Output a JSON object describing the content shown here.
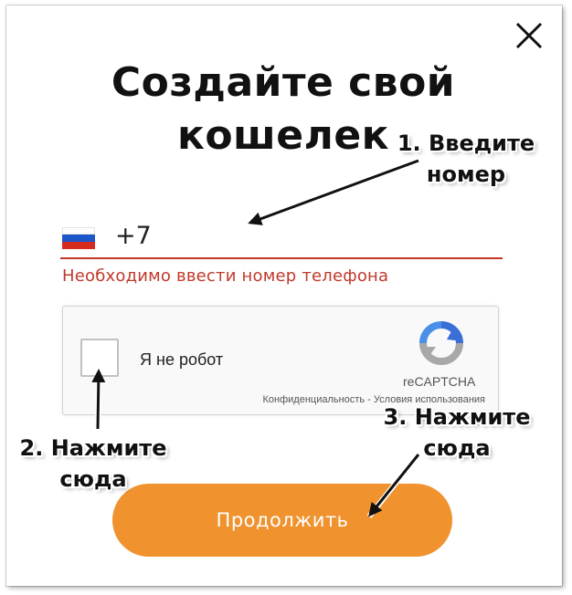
{
  "dialog": {
    "title_line1": "Создайте свой",
    "title_line2": "кошелек"
  },
  "phone": {
    "country_flag": "russia-flag-icon",
    "value": "+7",
    "error": "Необходимо ввести номер телефона"
  },
  "captcha": {
    "checkbox_label": "Я не робот",
    "brand": "reCAPTCHA",
    "privacy_link": "Конфиденциальность",
    "separator": "-",
    "terms_link": "Условия использования"
  },
  "submit": {
    "label": "Продолжить"
  },
  "annotations": {
    "step1_line1": "1. Введите",
    "step1_line2": "номер",
    "step2_line1": "2. Нажмите",
    "step2_line2": "сюда",
    "step3_line1": "3. Нажмите",
    "step3_line2": "сюда"
  },
  "colors": {
    "accent_button": "#f0922e",
    "error": "#c0392b"
  }
}
